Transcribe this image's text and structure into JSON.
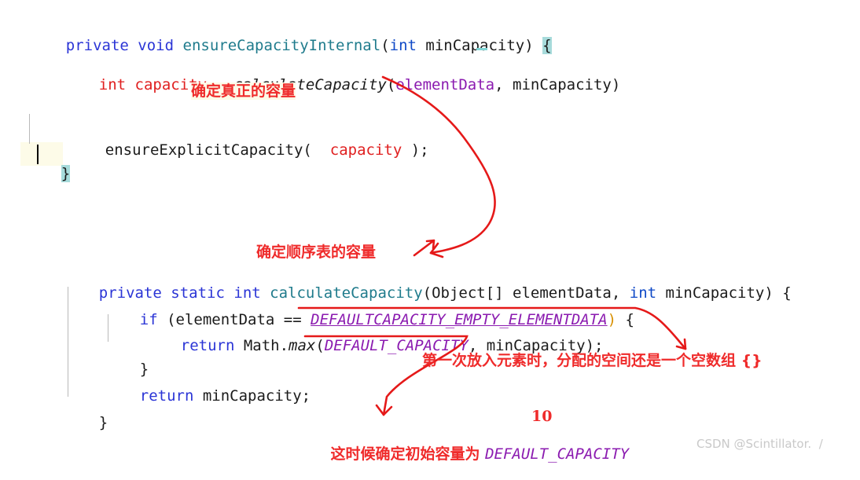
{
  "editor": {
    "background": "#ffffff",
    "accent_highlight": "#a7dbdb",
    "band_highlight": "#fdfbe8",
    "annotation_color": "#ef2b2b",
    "keyword_color": "#2b35d6",
    "method_color": "#1f7b8c",
    "field_color": "#8b1bb0",
    "string_red": "#e02020"
  },
  "code": {
    "line1": {
      "kw_private": "private",
      "sp1": " ",
      "kw_void": "void",
      "sp2": " ",
      "method_name": "ensureCapacityInternal",
      "paren_open": "(",
      "kw_int": "int",
      "sp3": " ",
      "param": "minCapacity",
      "paren_close": ") ",
      "brace": "{"
    },
    "line2": {
      "decl": "int capacity = ",
      "call": "calculateCapacity",
      "paren_open": "(",
      "arg1": "elementData",
      "comma": ", ",
      "arg2": "minCapacity",
      "paren_close": ")"
    },
    "line3": {
      "call": "ensureExplicitCapacity(",
      "spacer": "  ",
      "arg": "capacity",
      "tail": " );"
    },
    "line4": {
      "brace": "}"
    },
    "line5": {
      "kw_private": "private",
      "sp1": " ",
      "kw_static": "static",
      "sp2": " ",
      "kw_int": "int",
      "sp3": " ",
      "method_name": "calculateCapacity",
      "paren_open": "(",
      "type1": "Object[] elementData, ",
      "kw_int2": "int",
      "sp4": " ",
      "param2": "minCapacity) {"
    },
    "line6": {
      "kw_if": "if",
      "lead": " (elementData == ",
      "constant": "DEFAULTCAPACITY_EMPTY_ELEMENTDATA",
      "paren_close": ")",
      "tail": " {"
    },
    "line7": {
      "kw_return": "return",
      "obj": " Math.",
      "method": "max",
      "paren_open": "(",
      "constant": "DEFAULT_CAPACITY",
      "tail": ", minCapacity);"
    },
    "line8": {
      "brace": "}"
    },
    "line9": {
      "kw_return": "return",
      "tail": " minCapacity;"
    },
    "line10": {
      "brace": "}"
    }
  },
  "annotations": {
    "note1": "确定真正的容量",
    "note2": "确定顺序表的容量",
    "note3": "第一次放入元素时，分配的空间还是一个空数组 {}",
    "note4_prefix": "这时候确定初始容量为 ",
    "note4_constant": "DEFAULT_CAPACITY",
    "note5_value": "10"
  },
  "watermark": {
    "text": "CSDN @Scintillator.  /"
  }
}
